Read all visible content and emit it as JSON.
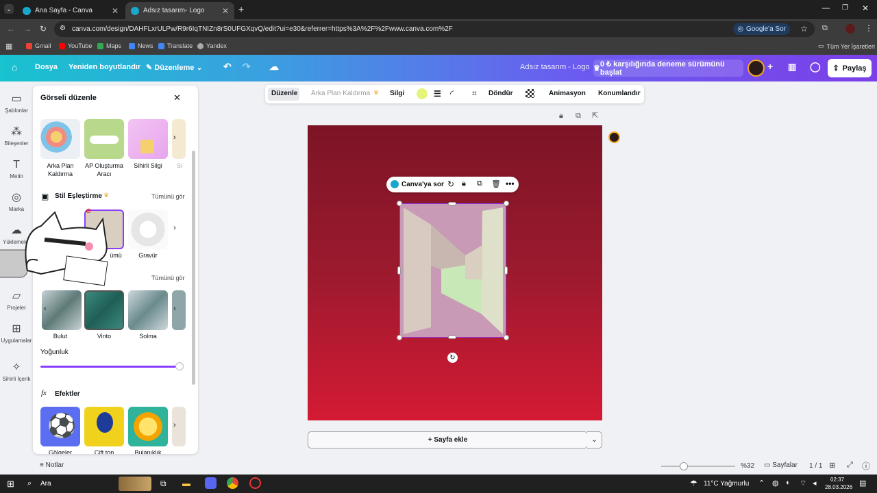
{
  "browser": {
    "tabs": [
      {
        "title": "Ana Sayfa - Canva"
      },
      {
        "title": "Adsız tasarım- Logo"
      }
    ],
    "url": "canva.com/design/DAHFLxrULPw/R9r6IqTNIZn8rS0UFGXqvQ/edit?ui=e30&referrer=https%3A%2F%2Fwww.canva.com%2F",
    "google_ask": "Google'a Sor",
    "bookmarks": [
      "Gmail",
      "YouTube",
      "Maps",
      "News",
      "Translate",
      "Yandex"
    ],
    "all_bookmarks": "Tüm Yer İşaretleri"
  },
  "header": {
    "file": "Dosya",
    "resize": "Yeniden boyutlandır",
    "edit": "Düzenleme",
    "title": "Adsız tasarım - Logo",
    "trial": "0 ₺ karşılığında deneme sürümünü başlat",
    "share": "Paylaş"
  },
  "rail": [
    {
      "label": "Şablonlar",
      "icon": "template-icon"
    },
    {
      "label": "Bileşenler",
      "icon": "elements-icon"
    },
    {
      "label": "Metin",
      "icon": "text-icon"
    },
    {
      "label": "Marka",
      "icon": "brand-icon"
    },
    {
      "label": "Yüklemeler",
      "icon": "upload-icon"
    },
    {
      "label": "Projeler",
      "icon": "folder-icon"
    },
    {
      "label": "Uygulamalar",
      "icon": "apps-icon"
    },
    {
      "label": "Sihirli İçerik",
      "icon": "magic-icon"
    }
  ],
  "panel": {
    "title": "Görseli düzenle",
    "tools": [
      {
        "label": "Arka Plan Kaldırma"
      },
      {
        "label": "AP Oluşturma Aracı"
      },
      {
        "label": "Sihirli Silgi"
      },
      {
        "label": "Si"
      }
    ],
    "style_match": "Stil Eşleştirme",
    "see_all": "Tümünü gör",
    "style_items": [
      {
        "label": "Gravür"
      },
      {
        "label": "ümü"
      }
    ],
    "filters": [
      {
        "label": "Bulut"
      },
      {
        "label": "Vinto"
      },
      {
        "label": "Solma"
      }
    ],
    "intensity": "Yoğunluk",
    "intensity_value": 1.0,
    "effects": "Efektler",
    "effect_items": [
      {
        "label": "Gölgeler"
      },
      {
        "label": "Çift ton"
      },
      {
        "label": "Bulanıklık"
      },
      {
        "label": "Sı"
      }
    ]
  },
  "toolbar": {
    "edit": "Düzenle",
    "bg_remove": "Arka Plan Kaldırma",
    "eraser": "Silgi",
    "rotate": "Döndür",
    "animation": "Animasyon",
    "position": "Konumlandır",
    "swatch_color": "#e6f47a"
  },
  "context": {
    "ask": "Canva'ya sor"
  },
  "canvas": {
    "add_page": "+ Sayfa ekle"
  },
  "footer": {
    "notes": "Notlar",
    "zoom": "%32",
    "pages": "Sayfalar",
    "page_count": "1 / 1"
  },
  "taskbar": {
    "search": "Ara",
    "weather": "11°C  Yağmurlu",
    "time": "02:37",
    "date": "28.03.2026"
  },
  "colors": {
    "accent": "#8b3dff",
    "canvas_top": "#7c1426",
    "canvas_bottom": "#d41a34"
  }
}
